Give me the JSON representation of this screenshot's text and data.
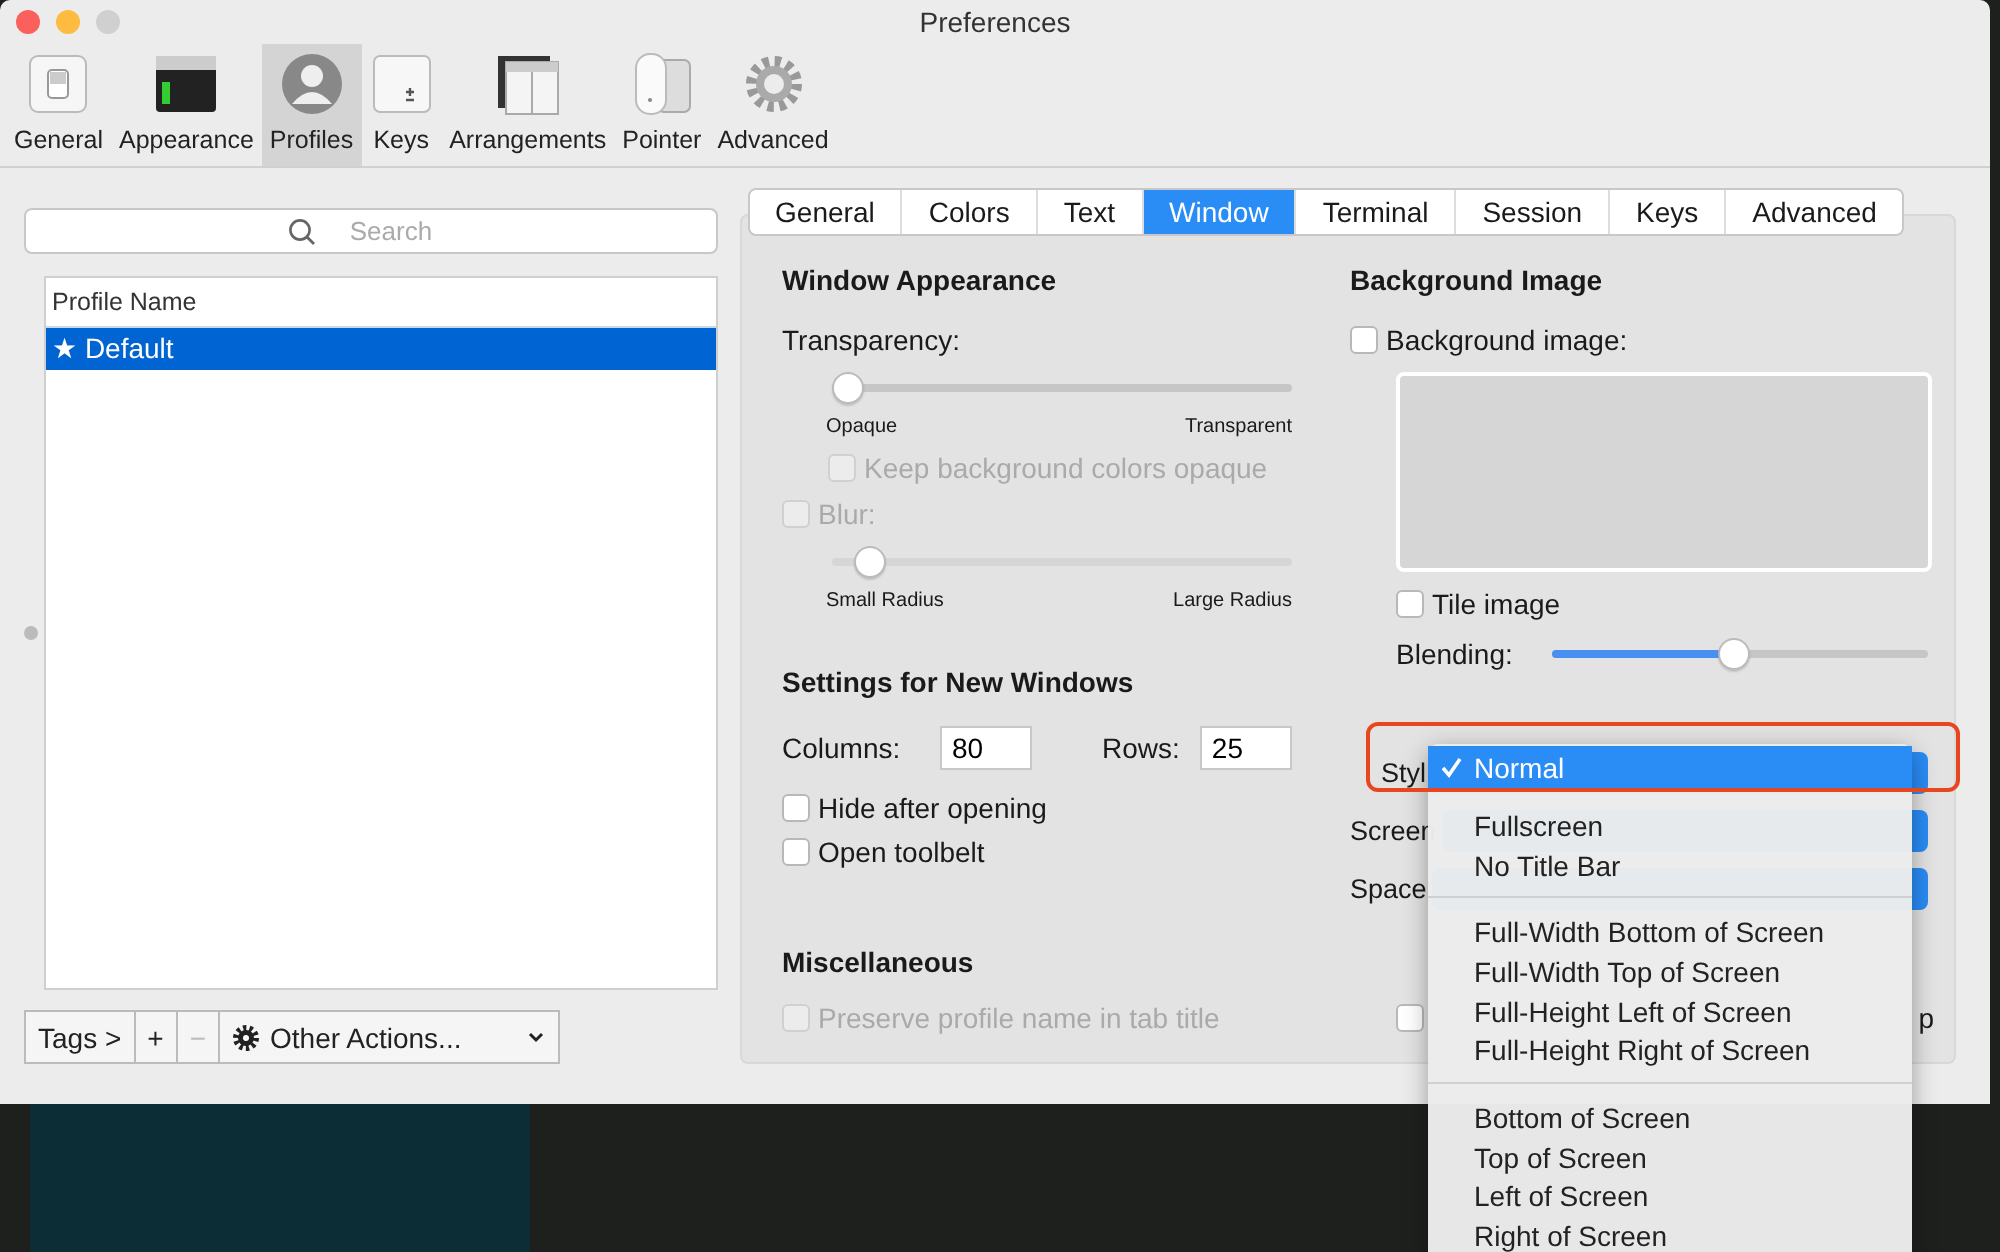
{
  "window": {
    "title": "Preferences",
    "traffic_lights": [
      {
        "color": "#fc605c"
      },
      {
        "color": "#fdbc40"
      },
      {
        "color": "#d0d0d0"
      }
    ]
  },
  "toolbar": [
    {
      "label": "General",
      "kind": "general",
      "selected": false
    },
    {
      "label": "Appearance",
      "kind": "appearance",
      "selected": false
    },
    {
      "label": "Profiles",
      "kind": "profiles",
      "selected": true
    },
    {
      "label": "Keys",
      "kind": "keys",
      "selected": false
    },
    {
      "label": "Arrangements",
      "kind": "arrangements",
      "selected": false
    },
    {
      "label": "Pointer",
      "kind": "pointer",
      "selected": false
    },
    {
      "label": "Advanced",
      "kind": "advanced",
      "selected": false
    }
  ],
  "profiles": {
    "search": {
      "placeholder": "Search"
    },
    "table": {
      "columns": [
        "Profile Name"
      ],
      "rows": [
        {
          "name": "★ Default",
          "selected": true
        }
      ]
    },
    "buttons": [
      {
        "label": "Tags >",
        "kind": "plain",
        "disabled": false
      },
      {
        "label": "+",
        "kind": "plain",
        "disabled": false
      },
      {
        "label": "−",
        "kind": "plain",
        "disabled": true
      },
      {
        "label": "Other Actions...",
        "kind": "menu",
        "disabled": false
      }
    ]
  },
  "tabs": [
    {
      "label": "General",
      "selected": false
    },
    {
      "label": "Colors",
      "selected": false
    },
    {
      "label": "Text",
      "selected": false
    },
    {
      "label": "Window",
      "selected": true
    },
    {
      "label": "Terminal",
      "selected": false
    },
    {
      "label": "Session",
      "selected": false
    },
    {
      "label": "Keys",
      "selected": false
    },
    {
      "label": "Advanced",
      "selected": false
    }
  ],
  "window_appearance": {
    "heading": "Window Appearance",
    "transparency": {
      "label": "Transparency:",
      "level": 0,
      "min_label": "Opaque",
      "max_label": "Transparent"
    },
    "keep_opaque": {
      "label": "Keep background colors opaque",
      "checked": false,
      "disabled": true
    },
    "blur": {
      "label": "Blur:",
      "checked": false,
      "disabled": true,
      "level": 0.05,
      "min_label": "Small Radius",
      "max_label": "Large Radius"
    }
  },
  "background_image": {
    "heading": "Background Image",
    "checkbox": {
      "label": "Background image:",
      "checked": false
    },
    "tile": {
      "label": "Tile image",
      "checked": false
    },
    "blending": {
      "label": "Blending:",
      "level": 0.48
    }
  },
  "new_windows": {
    "heading": "Settings for New Windows",
    "columns": {
      "label": "Columns:",
      "value": "80"
    },
    "rows": {
      "label": "Rows:",
      "value": "25"
    },
    "options": [
      {
        "label": "Hide after opening",
        "checked": false
      },
      {
        "label": "Open toolbelt",
        "checked": false
      }
    ]
  },
  "popups": [
    {
      "label": "Styl"
    },
    {
      "label": "Screen"
    },
    {
      "label": "Space"
    }
  ],
  "miscellaneous": {
    "heading": "Miscellaneous",
    "items": [
      {
        "label": "Preserve profile name in tab title",
        "checked": false,
        "disabled": true
      },
      {
        "label": "p",
        "checked": false,
        "disabled": false
      }
    ]
  },
  "style_menu": {
    "groups": [
      {
        "items": [
          {
            "label": "Normal",
            "selected": true
          },
          {
            "label": "Fullscreen",
            "selected": false
          },
          {
            "label": "No Title Bar",
            "selected": false
          }
        ]
      },
      {
        "items": [
          {
            "label": "Full-Width Bottom of Screen",
            "selected": false
          },
          {
            "label": "Full-Width Top of Screen",
            "selected": false
          },
          {
            "label": "Full-Height Left of Screen",
            "selected": false
          },
          {
            "label": "Full-Height Right of Screen",
            "selected": false
          }
        ]
      },
      {
        "items": [
          {
            "label": "Bottom of Screen",
            "selected": false
          },
          {
            "label": "Top of Screen",
            "selected": false
          },
          {
            "label": "Left of Screen",
            "selected": false
          },
          {
            "label": "Right of Screen",
            "selected": false
          }
        ]
      }
    ]
  },
  "annotation": {
    "kind": "frame"
  }
}
